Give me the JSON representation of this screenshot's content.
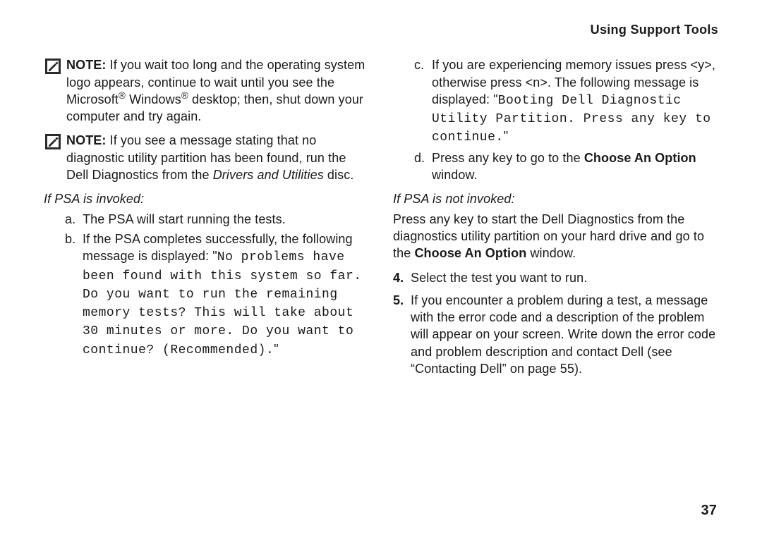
{
  "header": {
    "title": "Using Support Tools"
  },
  "left": {
    "note1": {
      "label": "NOTE:",
      "pre": " If you wait too long and the operating system logo appears, continue to wait until you see the Microsoft",
      "reg1": "®",
      "mid": " Windows",
      "reg2": "®",
      "post": " desktop; then, shut down your computer and try again."
    },
    "note2": {
      "label": "NOTE:",
      "pre": " If you see a message stating that no diagnostic utility partition has been found, run the Dell Diagnostics from the ",
      "italic": "Drivers and Utilities",
      "post": " disc."
    },
    "subhead": "If PSA is invoked:",
    "a": {
      "marker": "a.",
      "text": "The PSA will start running the tests."
    },
    "b": {
      "marker": "b.",
      "pre": "If the PSA completes successfully, the following message is displayed: \"",
      "mono": "No problems have been found with this system so far. Do you want to run the remaining memory tests? This will take about 30 minutes or more. Do you want to continue? (Recommended).",
      "post": "\""
    }
  },
  "right": {
    "c": {
      "marker": "c.",
      "pre": "If you are experiencing memory issues press <y>, otherwise press <n>. The following message is displayed: \"",
      "mono": "Booting Dell Diagnostic Utility Partition. Press any key to continue.",
      "post": "\""
    },
    "d": {
      "marker": "d.",
      "pre": "Press any key to go to the ",
      "bold": "Choose An Option",
      "post": " window."
    },
    "subhead": "If PSA is not invoked:",
    "para": {
      "pre": "Press any key to start the Dell Diagnostics from the diagnostics utility partition on your hard drive and go to the ",
      "bold": "Choose An Option",
      "post": " window."
    },
    "step4": {
      "marker": "4.",
      "text": "Select the test you want to run."
    },
    "step5": {
      "marker": "5.",
      "text": "If you encounter a problem during a test, a message with the error code and a description of the problem will appear on your screen. Write down the error code and problem description and contact Dell (see “Contacting Dell” on page 55)."
    }
  },
  "pageNumber": "37"
}
